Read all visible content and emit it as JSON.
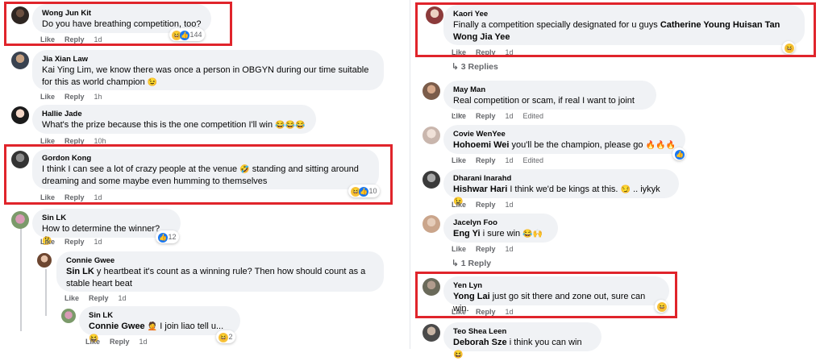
{
  "actions": {
    "like": "Like",
    "reply": "Reply",
    "edited": "Edited"
  },
  "left": {
    "c1": {
      "name": "Wong Jun Kit",
      "text": "Do you have breathing competition, too?",
      "time": "1d",
      "react_count": "144"
    },
    "c2": {
      "name": "Jia Xian Law",
      "line1": "Kai Ying Lim, we know there was once a person in OBGYN during our time suitable",
      "line2": "for this as world champion",
      "emoji": "😉",
      "time": "1h"
    },
    "c3": {
      "name": "Hallie Jade",
      "text": "What's the prize because this is the one competition I'll win",
      "emoji": "😂😂😂",
      "time": "10h"
    },
    "c4": {
      "name": "Gordon Kong",
      "line1a": "I think I can see a lot of crazy people at the venue",
      "line1emoji": "🤣",
      "line1b": "standing and sitting around",
      "line2": "dreaming and some maybe even humming to themselves",
      "time": "1d",
      "react_count": "10"
    },
    "c5": {
      "name": "Sin LK",
      "text": "How to determine the winner?",
      "emoji": "🤔",
      "time": "1d",
      "react_count": "12"
    },
    "c6": {
      "name": "Connie Gwee",
      "mention": "Sin LK",
      "line1": "y heartbeat it's count as a winning rule? Then how should count as a",
      "line2": "stable heart beat",
      "time": "1d"
    },
    "c7": {
      "name": "Sin LK",
      "mention": "Connie Gwee",
      "emoji1": "🤦",
      "text": "I join liao tell u...",
      "emoji2": "😆",
      "time": "1d",
      "react_count": "2"
    }
  },
  "right": {
    "c1": {
      "name": "Kaori Yee",
      "line1a": "Finally a competition specially designated for u guys",
      "mention1": "Catherine Young Huisan Tan",
      "mention2": "Wong Jia Yee",
      "time": "1d"
    },
    "replies1": "3 Replies",
    "c2": {
      "name": "May Man",
      "text": "Real competition or scam, if real I want to joint .....",
      "time": "1d"
    },
    "c3": {
      "name": "Covie WenYee",
      "mention": "Hohoemi Wei",
      "text": "you'll be the champion, please go",
      "emoji": "🔥🔥🔥",
      "time": "1d"
    },
    "c4": {
      "name": "Dharani Inarahd",
      "mention": "Hishwar Hari",
      "text": "I think we'd be kings at this.",
      "emoji": "😏",
      "tail": ".. iykyk",
      "emoji2": "😉",
      "time": "1d"
    },
    "c5": {
      "name": "Jacelyn Foo",
      "mention": "Eng Yi",
      "text": "i sure win",
      "emoji": "😂🙌",
      "time": "1d"
    },
    "replies2": "1 Reply",
    "c6": {
      "name": "Yen Lyn",
      "mention": "Yong Lai",
      "text": "just go sit there and zone out, sure can win.",
      "time": "1d"
    },
    "c7": {
      "name": "Teo Shea Leen",
      "mention": "Deborah Sze",
      "text": "i think you can win",
      "emoji": "😆"
    }
  },
  "icons": {
    "haha": "😆",
    "like": "👍",
    "love": "❤",
    "reply_arrow": "↳"
  }
}
